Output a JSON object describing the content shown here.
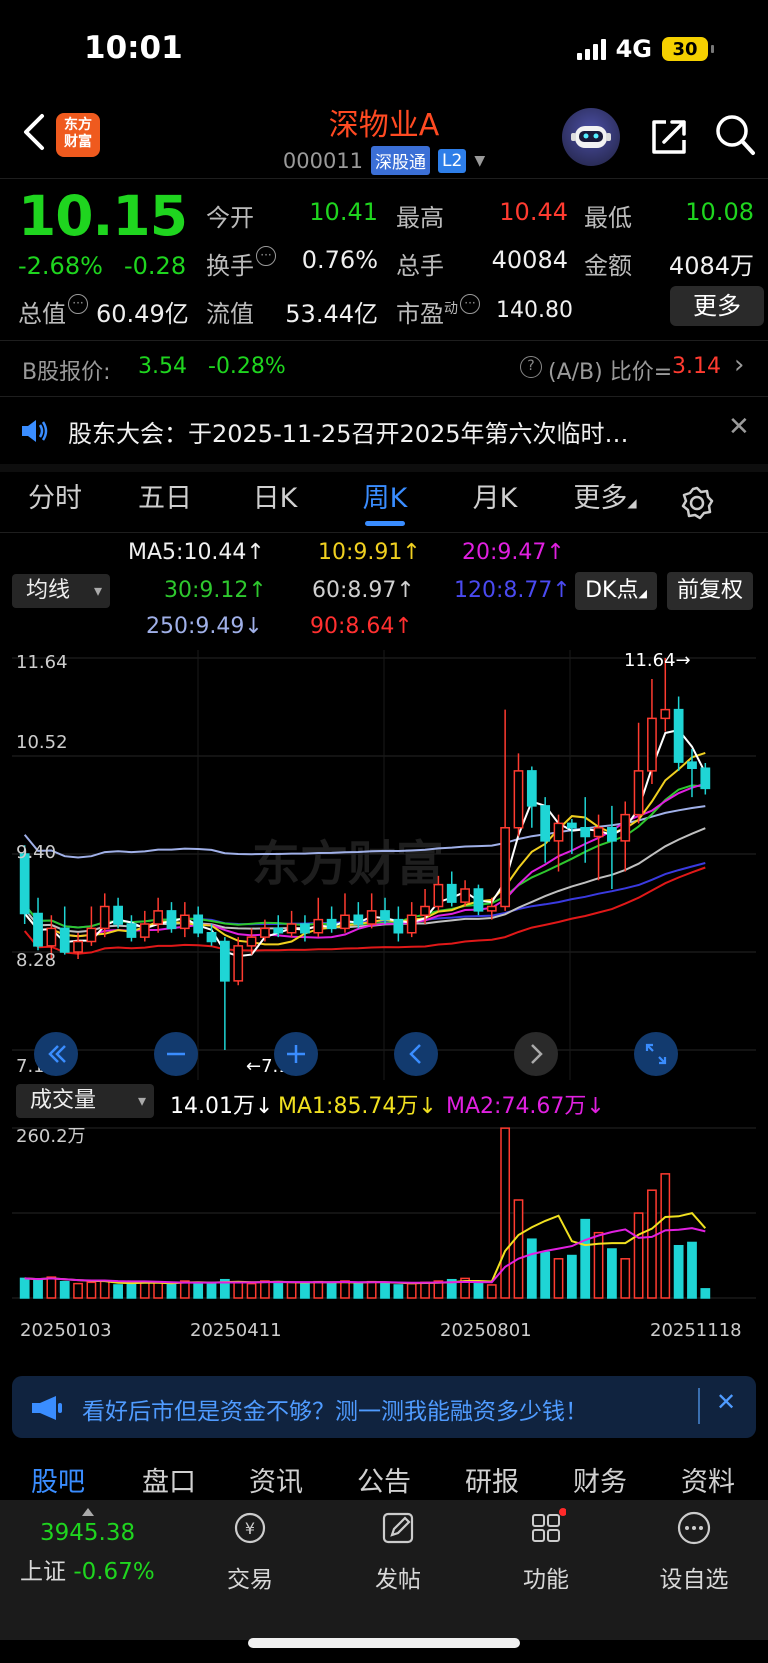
{
  "status": {
    "time": "10:01",
    "network": "4G",
    "battery": "30"
  },
  "header": {
    "logo": "东方财富",
    "name": "深物业A",
    "code": "000011",
    "tag1": "深股通",
    "tag2": "L2"
  },
  "quote": {
    "price": "10.15",
    "pct": "-2.68%",
    "change": "-0.28",
    "open_label": "今开",
    "open": "10.41",
    "high_label": "最高",
    "high": "10.44",
    "low_label": "最低",
    "low": "10.08",
    "turnover_label": "换手",
    "turnover": "0.76%",
    "volume_label": "总手",
    "volume": "40084",
    "amount_label": "金额",
    "amount": "4084万",
    "mcap_label": "总值",
    "mcap": "60.49亿",
    "float_label": "流值",
    "float": "53.44亿",
    "pe_label": "市盈",
    "pe_sup": "动",
    "pe": "140.80",
    "more": "更多"
  },
  "b_share": {
    "label": "B股报价:",
    "price": "3.54",
    "pct": "-0.28%",
    "ratio_label": "(A/B) 比价=",
    "ratio": "3.14"
  },
  "notice": {
    "text": "股东大会：于2025-11-25召开2025年第六次临时…"
  },
  "period_tabs": [
    "分时",
    "五日",
    "日K",
    "周K",
    "月K",
    "更多"
  ],
  "active_period": "周K",
  "ma": {
    "selector": "均线",
    "ma5": "MA5:10.44↑",
    "ma10": "10:9.91↑",
    "ma20": "20:9.47↑",
    "ma30": "30:9.12↑",
    "ma60": "60:8.97↑",
    "ma120": "120:8.77↑",
    "ma250": "250:9.49↓",
    "ma90": "90:8.64↑",
    "dk": "DK点",
    "adjust": "前复权"
  },
  "colors": {
    "up": "#ff3b30",
    "down": "#1fd5d5",
    "ma5": "#ffffff",
    "ma10": "#f0d020",
    "ma20": "#e020e0",
    "ma30": "#2ec82e",
    "ma60": "#c0c0c0",
    "ma120": "#3a3ae0",
    "ma250": "#a0b0e8",
    "ma90": "#e01818",
    "vol_ma1": "#f0e020",
    "vol_ma2": "#e020e0"
  },
  "k_axis": {
    "max": "11.64",
    "mid1": "10.52",
    "mid2": "9.40",
    "low": "8.28",
    "min": "7.16",
    "max_mark": "11.64→",
    "min_mark": "←7.16"
  },
  "volume": {
    "selector": "成交量",
    "value": "14.01万↓",
    "ma1": "MA1:85.74万↓",
    "ma2": "MA2:74.67万↓",
    "max": "260.2万"
  },
  "x_dates": [
    "20250103",
    "20250411",
    "20250801",
    "20251118"
  ],
  "chart_data": {
    "type": "candlestick",
    "ylim": [
      7.16,
      11.64
    ],
    "candles": [
      [
        9.4,
        8.72,
        9.5,
        8.6
      ],
      [
        8.72,
        8.35,
        8.9,
        8.3
      ],
      [
        8.35,
        8.55,
        8.7,
        8.2
      ],
      [
        8.55,
        8.28,
        8.8,
        8.25
      ],
      [
        8.28,
        8.4,
        8.5,
        8.2
      ],
      [
        8.4,
        8.55,
        8.8,
        8.35
      ],
      [
        8.55,
        8.8,
        8.95,
        8.45
      ],
      [
        8.8,
        8.6,
        8.9,
        8.55
      ],
      [
        8.6,
        8.45,
        8.7,
        8.4
      ],
      [
        8.45,
        8.6,
        8.75,
        8.4
      ],
      [
        8.6,
        8.75,
        8.9,
        8.5
      ],
      [
        8.75,
        8.55,
        8.85,
        8.5
      ],
      [
        8.55,
        8.7,
        8.85,
        8.45
      ],
      [
        8.7,
        8.5,
        8.8,
        8.45
      ],
      [
        8.5,
        8.4,
        8.6,
        8.35
      ],
      [
        8.4,
        7.95,
        8.45,
        7.16
      ],
      [
        7.95,
        8.35,
        8.45,
        7.9
      ],
      [
        8.35,
        8.45,
        8.55,
        8.25
      ],
      [
        8.45,
        8.55,
        8.65,
        8.4
      ],
      [
        8.55,
        8.5,
        8.7,
        8.45
      ],
      [
        8.5,
        8.6,
        8.75,
        8.45
      ],
      [
        8.6,
        8.5,
        8.7,
        8.4
      ],
      [
        8.5,
        8.65,
        8.9,
        8.45
      ],
      [
        8.65,
        8.55,
        8.8,
        8.5
      ],
      [
        8.55,
        8.7,
        8.95,
        8.5
      ],
      [
        8.7,
        8.6,
        8.85,
        8.55
      ],
      [
        8.6,
        8.75,
        8.95,
        8.55
      ],
      [
        8.75,
        8.65,
        8.9,
        8.6
      ],
      [
        8.65,
        8.5,
        8.8,
        8.4
      ],
      [
        8.5,
        8.7,
        8.85,
        8.45
      ],
      [
        8.7,
        8.8,
        9.0,
        8.6
      ],
      [
        8.8,
        9.05,
        9.15,
        8.75
      ],
      [
        9.05,
        8.85,
        9.2,
        8.8
      ],
      [
        8.85,
        9.0,
        9.1,
        8.8
      ],
      [
        9.0,
        8.75,
        9.05,
        8.7
      ],
      [
        8.75,
        8.8,
        8.9,
        8.65
      ],
      [
        8.8,
        9.7,
        11.05,
        8.75
      ],
      [
        9.7,
        10.35,
        10.55,
        9.6
      ],
      [
        10.35,
        9.95,
        10.4,
        9.7
      ],
      [
        9.95,
        9.55,
        10.05,
        9.3
      ],
      [
        9.55,
        9.75,
        9.85,
        9.2
      ],
      [
        9.75,
        9.7,
        9.8,
        9.4
      ],
      [
        9.7,
        9.6,
        10.05,
        9.3
      ],
      [
        9.6,
        9.7,
        9.85,
        9.1
      ],
      [
        9.7,
        9.55,
        9.95,
        9.0
      ],
      [
        9.55,
        9.85,
        10.0,
        9.2
      ],
      [
        9.85,
        10.35,
        10.9,
        9.75
      ],
      [
        10.35,
        10.95,
        11.4,
        10.2
      ],
      [
        10.95,
        11.05,
        11.64,
        10.8
      ],
      [
        11.05,
        10.45,
        11.2,
        10.35
      ],
      [
        10.45,
        10.38,
        10.6,
        10.05
      ],
      [
        10.38,
        10.15,
        10.44,
        10.08
      ]
    ],
    "volume_ylim": [
      0,
      260.2
    ],
    "volume": [
      30,
      28,
      32,
      25,
      22,
      24,
      26,
      20,
      22,
      25,
      24,
      22,
      26,
      24,
      22,
      28,
      24,
      22,
      26,
      25,
      24,
      22,
      25,
      24,
      26,
      22,
      25,
      24,
      20,
      22,
      24,
      26,
      28,
      30,
      22,
      20,
      260,
      150,
      90,
      70,
      60,
      65,
      120,
      100,
      75,
      60,
      130,
      165,
      190,
      80,
      85,
      14
    ]
  },
  "ad": {
    "text": "看好后市但是资金不够？测一测我能融资多少钱！"
  },
  "content_tabs": [
    "股吧",
    "盘口",
    "资讯",
    "公告",
    "研报",
    "财务",
    "资料"
  ],
  "toolbar": {
    "index_value": "3945.38",
    "index_name": "上证",
    "index_pct": "-0.67%",
    "trade": "交易",
    "post": "发帖",
    "func": "功能",
    "watch": "设自选"
  }
}
